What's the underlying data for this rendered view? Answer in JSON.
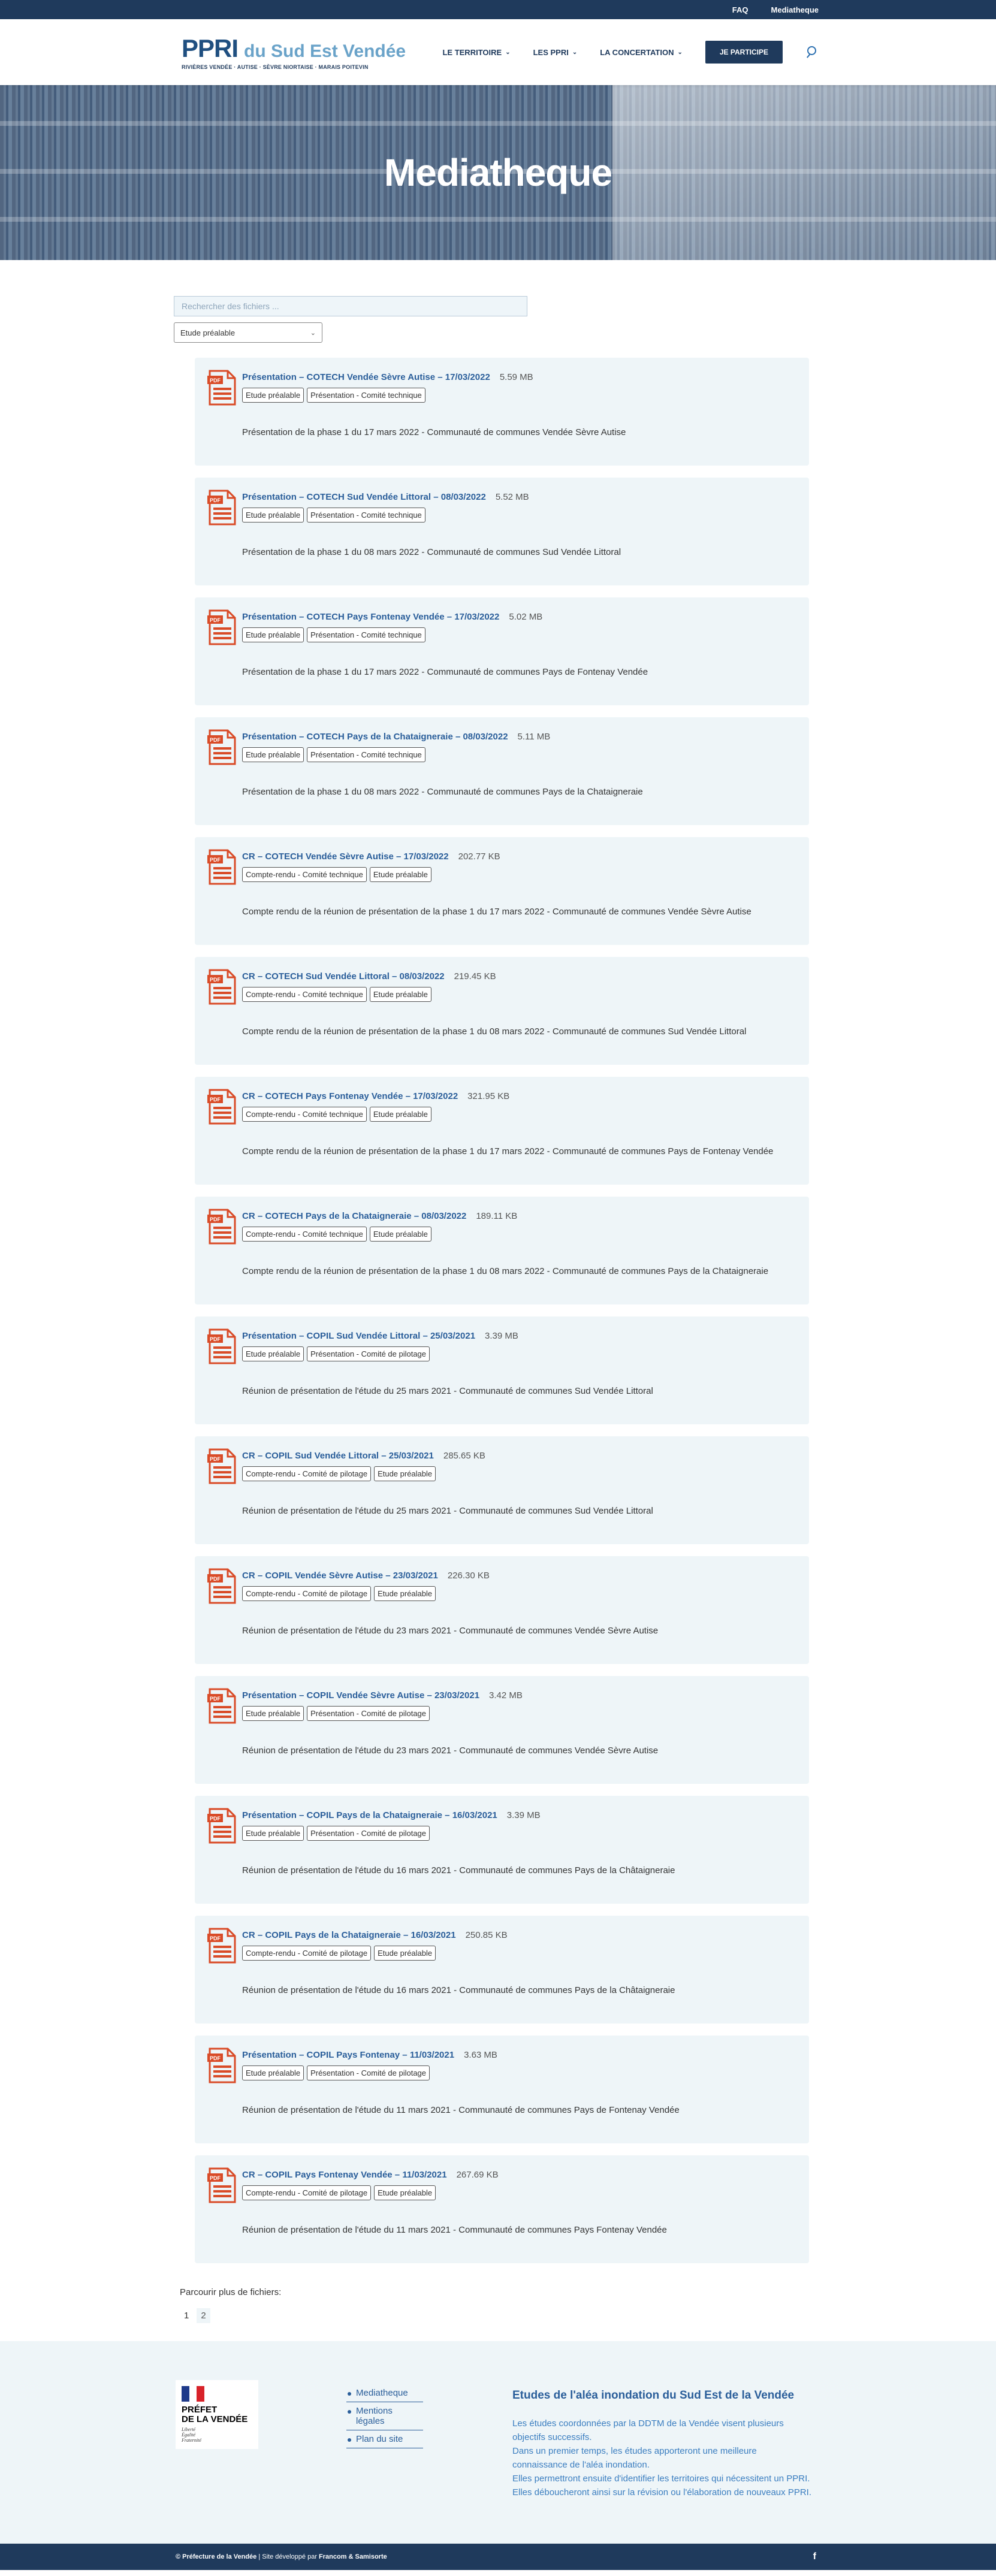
{
  "topbar": {
    "faq": "FAQ",
    "mediatheque": "Mediatheque"
  },
  "header": {
    "logo_ppri": "PPRI",
    "logo_sub": "du Sud Est Vendée",
    "logo_line": "RIVIÈRES VENDÉE · AUTISE · SÈVRE NIORTAISE · MARAIS POITEVIN",
    "nav": [
      {
        "label": "LE TERRITOIRE"
      },
      {
        "label": "LES PPRI"
      },
      {
        "label": "LA CONCERTATION"
      }
    ],
    "cta": "JE PARTICIPE"
  },
  "hero": {
    "title": "Mediatheque"
  },
  "search": {
    "placeholder": "Rechercher des fichiers ..."
  },
  "filter": {
    "selected": "Etude préalable"
  },
  "files": [
    {
      "title": "Présentation – COTECH Vendée Sèvre Autise – 17/03/2022",
      "size": "5.59 MB",
      "tags": [
        "Etude préalable",
        "Présentation - Comité technique"
      ],
      "desc": "Présentation de la phase 1 du 17 mars 2022 - Communauté de communes Vendée Sèvre Autise"
    },
    {
      "title": "Présentation – COTECH Sud Vendée Littoral – 08/03/2022",
      "size": "5.52 MB",
      "tags": [
        "Etude préalable",
        "Présentation - Comité technique"
      ],
      "desc": "Présentation de la phase 1 du 08 mars 2022 - Communauté de communes Sud Vendée Littoral"
    },
    {
      "title": "Présentation – COTECH Pays Fontenay Vendée – 17/03/2022",
      "size": "5.02 MB",
      "tags": [
        "Etude préalable",
        "Présentation - Comité technique"
      ],
      "desc": "Présentation de la phase 1 du 17 mars 2022 - Communauté de communes Pays de Fontenay Vendée"
    },
    {
      "title": "Présentation – COTECH Pays de la Chataigneraie – 08/03/2022",
      "size": "5.11 MB",
      "tags": [
        "Etude préalable",
        "Présentation - Comité technique"
      ],
      "desc": "Présentation de la phase 1 du 08 mars 2022 - Communauté de communes Pays de la Chataigneraie"
    },
    {
      "title": "CR – COTECH Vendée Sèvre Autise – 17/03/2022",
      "size": "202.77 KB",
      "tags": [
        "Compte-rendu - Comité technique",
        "Etude préalable"
      ],
      "desc": "Compte rendu de la réunion de présentation de la phase 1 du 17 mars 2022 - Communauté de communes Vendée Sèvre Autise"
    },
    {
      "title": "CR – COTECH Sud Vendée Littoral – 08/03/2022",
      "size": "219.45 KB",
      "tags": [
        "Compte-rendu - Comité technique",
        "Etude préalable"
      ],
      "desc": "Compte rendu de la réunion de présentation de la phase 1 du 08 mars 2022 - Communauté de communes Sud Vendée Littoral"
    },
    {
      "title": "CR – COTECH Pays Fontenay Vendée – 17/03/2022",
      "size": "321.95 KB",
      "tags": [
        "Compte-rendu - Comité technique",
        "Etude préalable"
      ],
      "desc": "Compte rendu de la réunion de présentation de la phase 1 du 17 mars 2022 - Communauté de communes Pays de Fontenay Vendée"
    },
    {
      "title": "CR – COTECH Pays de la Chataigneraie – 08/03/2022",
      "size": "189.11 KB",
      "tags": [
        "Compte-rendu - Comité technique",
        "Etude préalable"
      ],
      "desc": "Compte rendu de la réunion de présentation de la phase 1 du 08 mars 2022 - Communauté de communes Pays de la Chataigneraie"
    },
    {
      "title": "Présentation – COPIL Sud Vendée Littoral – 25/03/2021",
      "size": "3.39 MB",
      "tags": [
        "Etude préalable",
        "Présentation - Comité de pilotage"
      ],
      "desc": "Réunion de présentation de l'étude du 25 mars 2021 - Communauté de communes Sud Vendée Littoral"
    },
    {
      "title": "CR – COPIL Sud Vendée Littoral – 25/03/2021",
      "size": "285.65 KB",
      "tags": [
        "Compte-rendu - Comité de pilotage",
        "Etude préalable"
      ],
      "desc": "Réunion de présentation de l'étude du 25 mars 2021 - Communauté de communes Sud Vendée Littoral"
    },
    {
      "title": "CR – COPIL Vendée Sèvre Autise – 23/03/2021",
      "size": "226.30 KB",
      "tags": [
        "Compte-rendu - Comité de pilotage",
        "Etude préalable"
      ],
      "desc": "Réunion de présentation de l'étude du 23 mars 2021 - Communauté de communes Vendée Sèvre Autise"
    },
    {
      "title": "Présentation – COPIL Vendée Sèvre Autise – 23/03/2021",
      "size": "3.42 MB",
      "tags": [
        "Etude préalable",
        "Présentation - Comité de pilotage"
      ],
      "desc": "Réunion de présentation de l'étude du 23 mars 2021 - Communauté de communes Vendée Sèvre Autise"
    },
    {
      "title": "Présentation – COPIL Pays de la Chataigneraie – 16/03/2021",
      "size": "3.39 MB",
      "tags": [
        "Etude préalable",
        "Présentation - Comité de pilotage"
      ],
      "desc": "Réunion de présentation de l'étude du 16 mars 2021 - Communauté de communes Pays de la Châtaigneraie"
    },
    {
      "title": "CR – COPIL Pays de la Chataigneraie – 16/03/2021",
      "size": "250.85 KB",
      "tags": [
        "Compte-rendu - Comité de pilotage",
        "Etude préalable"
      ],
      "desc": "Réunion de présentation de l'étude du 16 mars 2021 - Communauté de communes Pays de la Châtaigneraie"
    },
    {
      "title": "Présentation – COPIL Pays Fontenay – 11/03/2021",
      "size": "3.63 MB",
      "tags": [
        "Etude préalable",
        "Présentation - Comité de pilotage"
      ],
      "desc": "Réunion de présentation de l'étude du 11 mars 2021 - Communauté de communes Pays de Fontenay Vendée"
    },
    {
      "title": "CR – COPIL Pays Fontenay Vendée – 11/03/2021",
      "size": "267.69 KB",
      "tags": [
        "Compte-rendu - Comité de pilotage",
        "Etude préalable"
      ],
      "desc": "Réunion de présentation de l'étude du 11 mars 2021 - Communauté de communes Pays Fontenay Vendée"
    }
  ],
  "pagination": {
    "label": "Parcourir plus de fichiers:",
    "current": "1",
    "next": "2"
  },
  "footer": {
    "logo": {
      "line1": "PRÉFET",
      "line2": "DE LA VENDÉE",
      "devise": [
        "Liberté",
        "Égalité",
        "Fraternité"
      ]
    },
    "links": [
      "Mediatheque",
      "Mentions légales",
      "Plan du site"
    ],
    "info_title": "Etudes de l'aléa inondation du Sud Est de la Vendée",
    "info_lines": [
      "Les études coordonnées par la DDTM de la Vendée visent plusieurs objectifs successifs.",
      "Dans un premier temps, les études apporteront une meilleure connaissance de l'aléa inondation.",
      "Elles permettront ensuite d'identifier les territoires qui nécessitent un PPRI.",
      "Elles déboucheront ainsi sur la révision ou l'élaboration de nouveaux PPRI."
    ]
  },
  "bottombar": {
    "copy_prefix": "© Préfecture de la Vendée",
    "copy_mid": " | Site développé par ",
    "copy_dev": "Francom & Samisorte",
    "fb": "f"
  },
  "colors": {
    "primary": "#1f3a5c",
    "link": "#2a5e9a",
    "pdf": "#d94b27",
    "card_bg": "#eef5f8"
  }
}
